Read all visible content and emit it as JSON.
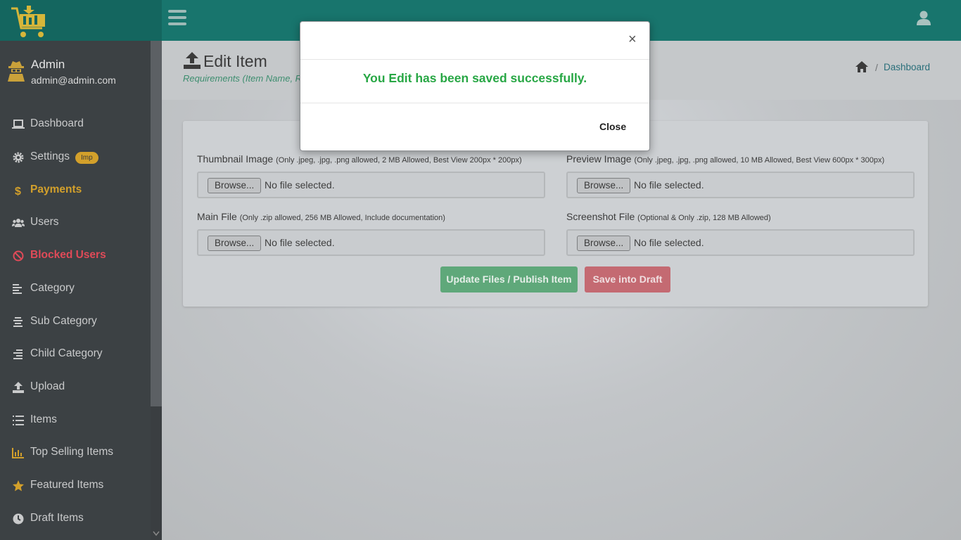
{
  "colors": {
    "header": "#18756d",
    "sidebar": "#3c4144",
    "accent_gold": "#d3a02b",
    "danger": "#e04a58",
    "success": "#28a745"
  },
  "sidebar": {
    "profile": {
      "name": "Admin",
      "email": "admin@admin.com"
    },
    "items": [
      {
        "label": "Dashboard",
        "icon": "laptop-icon"
      },
      {
        "label": "Settings",
        "icon": "gear-icon",
        "badge": "Imp"
      },
      {
        "label": "Payments",
        "icon": "dollar-icon"
      },
      {
        "label": "Users",
        "icon": "users-icon"
      },
      {
        "label": "Blocked Users",
        "icon": "ban-icon"
      },
      {
        "label": "Category",
        "icon": "align-left-icon"
      },
      {
        "label": "Sub Category",
        "icon": "align-center-icon"
      },
      {
        "label": "Child Category",
        "icon": "align-right-icon"
      },
      {
        "label": "Upload",
        "icon": "upload-icon"
      },
      {
        "label": "Items",
        "icon": "list-icon"
      },
      {
        "label": "Top Selling Items",
        "icon": "bar-chart-icon"
      },
      {
        "label": "Featured Items",
        "icon": "star-icon"
      },
      {
        "label": "Draft Items",
        "icon": "clock-icon"
      }
    ]
  },
  "page": {
    "title": "Edit Item",
    "subtitle": "Requirements (Item Name, Re",
    "breadcrumb": {
      "current": "Dashboard"
    }
  },
  "form": {
    "fields": [
      {
        "label": "Thumbnail Image",
        "hint": "(Only .jpeg, .jpg, .png allowed, 2 MB Allowed, Best View 200px * 200px)",
        "browse": "Browse...",
        "status": "No file selected."
      },
      {
        "label": "Preview Image",
        "hint": "(Only .jpeg, .jpg, .png allowed, 10 MB Allowed, Best View 600px * 300px)",
        "browse": "Browse...",
        "status": "No file selected."
      },
      {
        "label": "Main File",
        "hint": "(Only .zip allowed, 256 MB Allowed, Include documentation)",
        "browse": "Browse...",
        "status": "No file selected."
      },
      {
        "label": "Screenshot File",
        "hint": "(Optional & Only .zip, 128 MB Allowed)",
        "browse": "Browse...",
        "status": "No file selected."
      }
    ],
    "publish_label": "Update Files / Publish Item",
    "draft_label": "Save into Draft"
  },
  "modal": {
    "close_x": "×",
    "message": "You Edit has been saved successfully.",
    "close_label": "Close"
  }
}
